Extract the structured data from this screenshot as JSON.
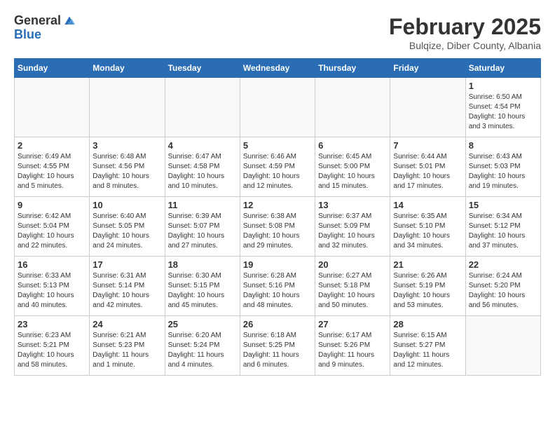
{
  "logo": {
    "general": "General",
    "blue": "Blue"
  },
  "title": {
    "month": "February 2025",
    "location": "Bulqize, Diber County, Albania"
  },
  "weekdays": [
    "Sunday",
    "Monday",
    "Tuesday",
    "Wednesday",
    "Thursday",
    "Friday",
    "Saturday"
  ],
  "weeks": [
    [
      {
        "day": "",
        "info": ""
      },
      {
        "day": "",
        "info": ""
      },
      {
        "day": "",
        "info": ""
      },
      {
        "day": "",
        "info": ""
      },
      {
        "day": "",
        "info": ""
      },
      {
        "day": "",
        "info": ""
      },
      {
        "day": "1",
        "info": "Sunrise: 6:50 AM\nSunset: 4:54 PM\nDaylight: 10 hours\nand 3 minutes."
      }
    ],
    [
      {
        "day": "2",
        "info": "Sunrise: 6:49 AM\nSunset: 4:55 PM\nDaylight: 10 hours\nand 5 minutes."
      },
      {
        "day": "3",
        "info": "Sunrise: 6:48 AM\nSunset: 4:56 PM\nDaylight: 10 hours\nand 8 minutes."
      },
      {
        "day": "4",
        "info": "Sunrise: 6:47 AM\nSunset: 4:58 PM\nDaylight: 10 hours\nand 10 minutes."
      },
      {
        "day": "5",
        "info": "Sunrise: 6:46 AM\nSunset: 4:59 PM\nDaylight: 10 hours\nand 12 minutes."
      },
      {
        "day": "6",
        "info": "Sunrise: 6:45 AM\nSunset: 5:00 PM\nDaylight: 10 hours\nand 15 minutes."
      },
      {
        "day": "7",
        "info": "Sunrise: 6:44 AM\nSunset: 5:01 PM\nDaylight: 10 hours\nand 17 minutes."
      },
      {
        "day": "8",
        "info": "Sunrise: 6:43 AM\nSunset: 5:03 PM\nDaylight: 10 hours\nand 19 minutes."
      }
    ],
    [
      {
        "day": "9",
        "info": "Sunrise: 6:42 AM\nSunset: 5:04 PM\nDaylight: 10 hours\nand 22 minutes."
      },
      {
        "day": "10",
        "info": "Sunrise: 6:40 AM\nSunset: 5:05 PM\nDaylight: 10 hours\nand 24 minutes."
      },
      {
        "day": "11",
        "info": "Sunrise: 6:39 AM\nSunset: 5:07 PM\nDaylight: 10 hours\nand 27 minutes."
      },
      {
        "day": "12",
        "info": "Sunrise: 6:38 AM\nSunset: 5:08 PM\nDaylight: 10 hours\nand 29 minutes."
      },
      {
        "day": "13",
        "info": "Sunrise: 6:37 AM\nSunset: 5:09 PM\nDaylight: 10 hours\nand 32 minutes."
      },
      {
        "day": "14",
        "info": "Sunrise: 6:35 AM\nSunset: 5:10 PM\nDaylight: 10 hours\nand 34 minutes."
      },
      {
        "day": "15",
        "info": "Sunrise: 6:34 AM\nSunset: 5:12 PM\nDaylight: 10 hours\nand 37 minutes."
      }
    ],
    [
      {
        "day": "16",
        "info": "Sunrise: 6:33 AM\nSunset: 5:13 PM\nDaylight: 10 hours\nand 40 minutes."
      },
      {
        "day": "17",
        "info": "Sunrise: 6:31 AM\nSunset: 5:14 PM\nDaylight: 10 hours\nand 42 minutes."
      },
      {
        "day": "18",
        "info": "Sunrise: 6:30 AM\nSunset: 5:15 PM\nDaylight: 10 hours\nand 45 minutes."
      },
      {
        "day": "19",
        "info": "Sunrise: 6:28 AM\nSunset: 5:16 PM\nDaylight: 10 hours\nand 48 minutes."
      },
      {
        "day": "20",
        "info": "Sunrise: 6:27 AM\nSunset: 5:18 PM\nDaylight: 10 hours\nand 50 minutes."
      },
      {
        "day": "21",
        "info": "Sunrise: 6:26 AM\nSunset: 5:19 PM\nDaylight: 10 hours\nand 53 minutes."
      },
      {
        "day": "22",
        "info": "Sunrise: 6:24 AM\nSunset: 5:20 PM\nDaylight: 10 hours\nand 56 minutes."
      }
    ],
    [
      {
        "day": "23",
        "info": "Sunrise: 6:23 AM\nSunset: 5:21 PM\nDaylight: 10 hours\nand 58 minutes."
      },
      {
        "day": "24",
        "info": "Sunrise: 6:21 AM\nSunset: 5:23 PM\nDaylight: 11 hours\nand 1 minute."
      },
      {
        "day": "25",
        "info": "Sunrise: 6:20 AM\nSunset: 5:24 PM\nDaylight: 11 hours\nand 4 minutes."
      },
      {
        "day": "26",
        "info": "Sunrise: 6:18 AM\nSunset: 5:25 PM\nDaylight: 11 hours\nand 6 minutes."
      },
      {
        "day": "27",
        "info": "Sunrise: 6:17 AM\nSunset: 5:26 PM\nDaylight: 11 hours\nand 9 minutes."
      },
      {
        "day": "28",
        "info": "Sunrise: 6:15 AM\nSunset: 5:27 PM\nDaylight: 11 hours\nand 12 minutes."
      },
      {
        "day": "",
        "info": ""
      }
    ]
  ]
}
